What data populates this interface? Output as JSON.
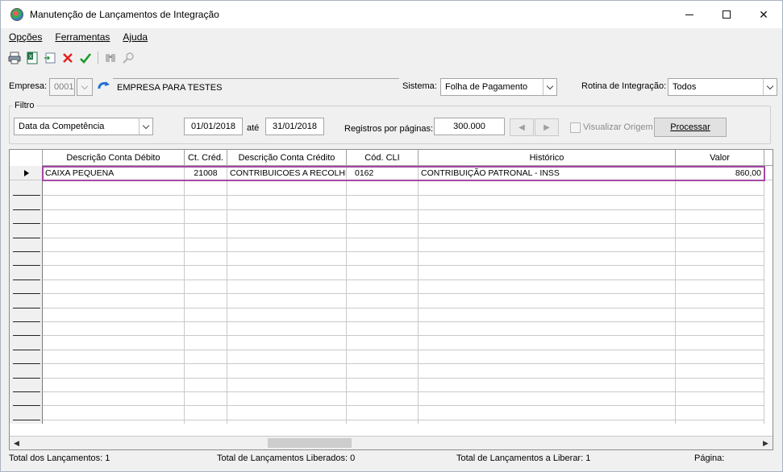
{
  "window": {
    "title": "Manutenção de Lançamentos de Integração"
  },
  "menu": {
    "items": [
      "Opções",
      "Ferramentas",
      "Ajuda"
    ]
  },
  "toolbar": {
    "icons": [
      "printer-icon",
      "excel-export-icon",
      "import-icon",
      "delete-icon",
      "confirm-icon",
      "binoculars-icon",
      "magnifier-icon"
    ]
  },
  "form": {
    "empresa_label": "Empresa:",
    "empresa_code": "0001",
    "empresa_name": "EMPRESA PARA TESTES",
    "sistema_label": "Sistema:",
    "sistema_value": "Folha de Pagamento",
    "rotina_label": "Rotina de Integração:",
    "rotina_value": "Todos"
  },
  "filter": {
    "title": "Filtro",
    "type_value": "Data da Competência",
    "date_from": "01/01/2018",
    "ate_label": "até",
    "date_to": "31/01/2018",
    "registros_label": "Registros por páginas:",
    "registros_value": "300.000",
    "visualizar_label": "Visualizar Origem",
    "processar_label": "Processar"
  },
  "grid": {
    "columns": [
      "Descrição Conta Débito",
      "Ct. Créd.",
      "Descrição Conta Crédito",
      "Cód. CLI",
      "Histórico",
      "Valor"
    ],
    "rows": [
      [
        "CAIXA PEQUENA",
        "21008",
        "CONTRIBUICOES A RECOLHER",
        "0162",
        "CONTRIBUIÇÃO PATRONAL - INSS",
        "860,00"
      ]
    ]
  },
  "status": {
    "total_lancamentos": "Total dos Lançamentos: 1",
    "total_liberados": "Total de Lançamentos Liberados: 0",
    "total_a_liberar": "Total de Lançamentos a Liberar: 1",
    "pagina": "Página:"
  },
  "colors": {
    "selection": "#a349a4"
  }
}
